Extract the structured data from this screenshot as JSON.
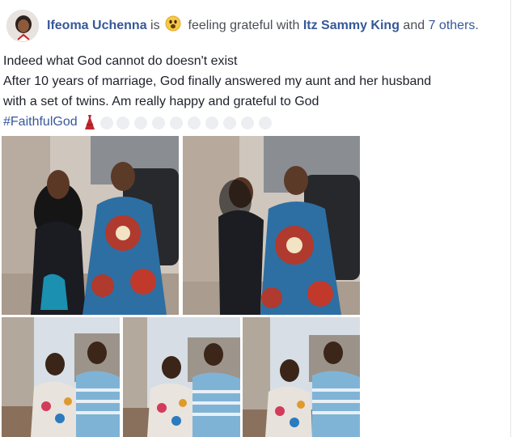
{
  "post": {
    "author": "Ifeoma Uchenna",
    "is_word": "is",
    "feeling": "feeling grateful with",
    "tagged_user": "Itz Sammy King",
    "and_word": "and",
    "others_link": "7 others",
    "period": ".",
    "lines": [
      "Indeed what God cannot do doesn't exist",
      "After 10 years of marriage, God finally answered my aunt and her husband",
      "with a set of twins. Am really happy and grateful to God"
    ],
    "hashtag": "#FaithfulGod",
    "feeling_icon": "smiley-emoji-icon",
    "dress_icon": "red-dress-emoji-icon"
  },
  "colors": {
    "link": "#365899",
    "text": "#1d2129",
    "emoji_yellow": "#f7c948",
    "dress_red": "#c1272d"
  }
}
